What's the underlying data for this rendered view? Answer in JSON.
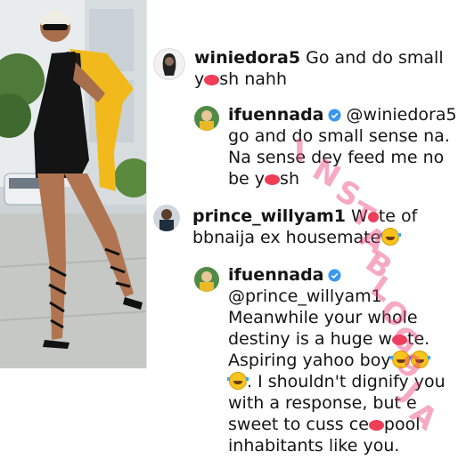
{
  "comments": [
    {
      "username": "winiedora5",
      "lines": [
        "Go and do small",
        "y",
        "sh nahh"
      ]
    },
    {
      "username": "ifuennada",
      "mention": "@winiedora5",
      "lines": [
        "go and do small sense na.",
        "Na sense dey feed me no",
        "be y",
        "sh"
      ]
    },
    {
      "username": "prince_willyam1",
      "lines": [
        "W",
        "te of",
        "bbnaija ex housemate"
      ]
    },
    {
      "username": "ifuennada",
      "mention": "@prince_willyam1",
      "lines": [
        "Meanwhile your whole",
        "destiny is a huge w",
        "te.",
        "Aspiring yahoo boy",
        ". I shouldn't dignify you",
        "with a response, but e",
        "sweet to cuss ce",
        "pool",
        "inhabitants like you."
      ]
    }
  ],
  "watermark": {
    "letters": [
      "I",
      "N",
      "S",
      "T",
      "A",
      "B",
      "L",
      "O",
      "G",
      "9",
      "J",
      "A"
    ]
  },
  "colors": {
    "verified": "#3897f0",
    "censor": "#ef3e58",
    "watermark": "#ec407a"
  },
  "icons": [
    "verified-badge-icon",
    "laughing-emoji-icon",
    "censor-blot-icon"
  ]
}
